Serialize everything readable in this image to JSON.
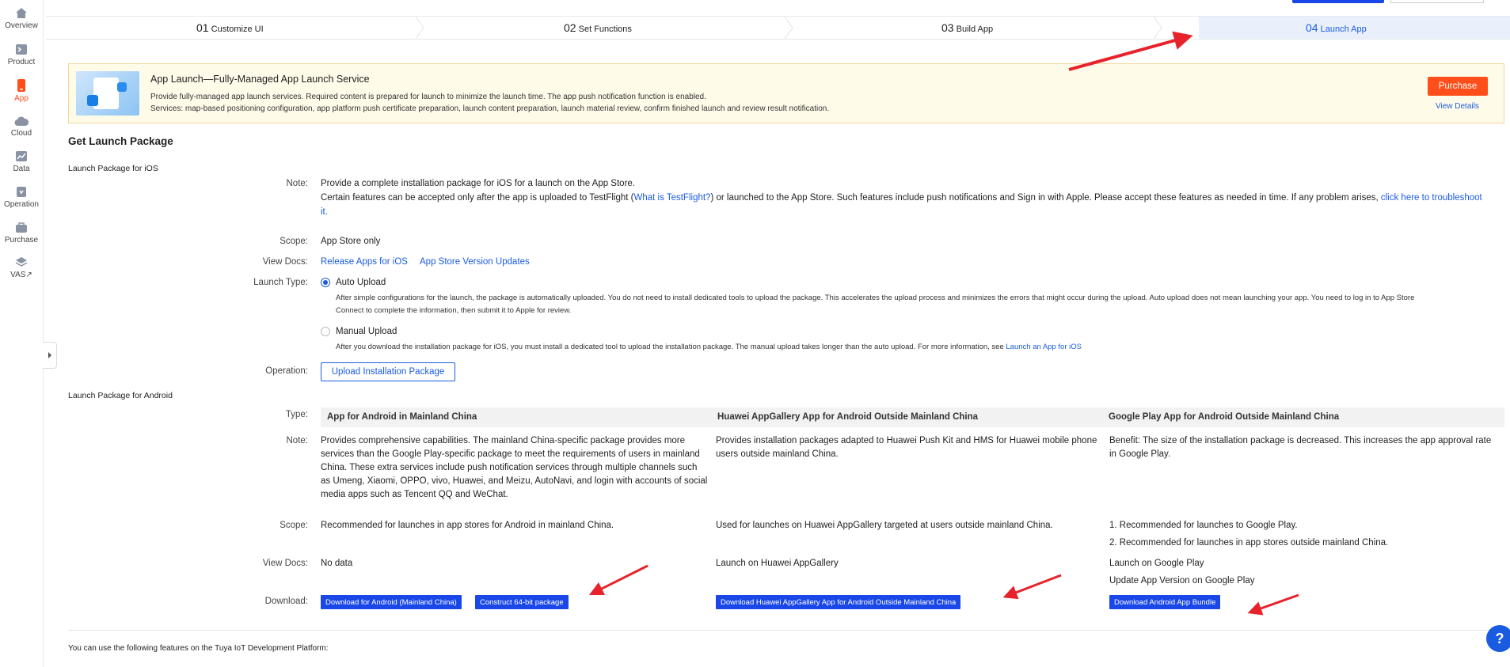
{
  "sidebar": {
    "items": [
      {
        "label": "Overview",
        "icon": "home-icon"
      },
      {
        "label": "Product",
        "icon": "product-icon"
      },
      {
        "label": "App",
        "icon": "app-icon"
      },
      {
        "label": "Cloud",
        "icon": "cloud-icon"
      },
      {
        "label": "Data",
        "icon": "chart-icon"
      },
      {
        "label": "Operation",
        "icon": "operation-icon"
      },
      {
        "label": "Purchase",
        "icon": "purchase-icon"
      },
      {
        "label": "VAS",
        "icon": "vas-icon"
      }
    ],
    "active_color": "#ff4d1a"
  },
  "steps": [
    {
      "num": "01",
      "label": "Customize UI"
    },
    {
      "num": "02",
      "label": "Set Functions"
    },
    {
      "num": "03",
      "label": "Build App"
    },
    {
      "num": "04",
      "label": "Launch App"
    }
  ],
  "banner": {
    "title": "App Launch—Fully-Managed App Launch Service",
    "line1": "Provide fully-managed app launch services. Required content is prepared for launch to minimize the launch time. The app push notification function is enabled.",
    "line2": "Services: map-based positioning configuration, app platform push certificate preparation, launch content preparation, launch material review, confirm finished launch and review result notification.",
    "purchase_label": "Purchase",
    "view_details": "View Details"
  },
  "main": {
    "title": "Get Launch Package",
    "ios": {
      "heading": "Launch Package for iOS",
      "note_label": "Note:",
      "note1": "Provide a complete installation package for iOS for a launch on the App Store.",
      "note2a": "Certain features can be accepted only after the app is uploaded to TestFlight (",
      "note2_link": "What is TestFlight?",
      "note2b": ") or launched to the App Store. Such features include push notifications and Sign in with Apple. Please accept these features as needed in time. If any problem arises,",
      "note2_link2": "click here to troubleshoot",
      "note2_link3": "it.",
      "scope_label": "Scope:",
      "scope": "App Store only",
      "docs_label": "View Docs:",
      "doc1": "Release Apps for iOS",
      "doc2": "App Store Version Updates",
      "launch_type_label": "Launch Type:",
      "auto_label": "Auto Upload",
      "auto_desc1": "After simple configurations for the launch, the package is automatically uploaded. You do not need to install dedicated tools to upload the package. This accelerates the upload process and minimizes the errors that might occur during the upload. Auto upload does not mean launching your app. You need to log in to App Store",
      "auto_desc2": "Connect to complete the information, then submit it to Apple for review.",
      "manual_label": "Manual Upload",
      "manual_desc": "After you download the installation package for iOS, you must install a dedicated tool to upload the installation package. The manual upload takes longer than the auto upload. For more information, see",
      "manual_link": "Launch an App for iOS",
      "operation_label": "Operation:",
      "upload_button": "Upload Installation Package"
    },
    "android": {
      "heading": "Launch Package for Android",
      "type_label": "Type:",
      "note_label": "Note:",
      "scope_label": "Scope:",
      "docs_label": "View Docs:",
      "download_label": "Download:",
      "columns": [
        {
          "header": "App for Android in Mainland China",
          "note_lines": [
            "Provides comprehensive capabilities. The mainland China-specific package provides more",
            "services than the Google Play-specific package to meet the requirements of users in mainland",
            "China. These extra services include push notification services through multiple channels such",
            "as Umeng, Xiaomi, OPPO, vivo, Huawei, and Meizu, AutoNavi, and login with accounts of social",
            "media apps such as Tencent QQ and WeChat."
          ],
          "scope": "Recommended for launches in app stores for Android in mainland China.",
          "docs": "No data",
          "buttons": [
            "Download for Android (Mainland China)",
            "Construct 64-bit package"
          ]
        },
        {
          "header": "Huawei AppGallery App for Android Outside Mainland China",
          "note_lines": [
            "Provides installation packages adapted to Huawei Push Kit and HMS for Huawei mobile phone",
            "users outside mainland China."
          ],
          "scope": "Used for launches on Huawei AppGallery targeted at users outside mainland China.",
          "docs": "Launch on Huawei AppGallery",
          "buttons": [
            "Download Huawei AppGallery App for Android Outside Mainland China"
          ]
        },
        {
          "header": "Google Play App for Android Outside Mainland China",
          "note_lines": [
            "Benefit: The size of the installation package is decreased. This increases the app approval rate",
            "in Google Play."
          ],
          "scope1": "1. Recommended for launches to Google Play.",
          "scope2": "2. Recommended for launches in app stores outside mainland China.",
          "docs1": "Launch on Google Play",
          "docs2": "Update App Version on Google Play",
          "buttons": [
            "Download Android App Bundle"
          ]
        }
      ]
    },
    "footer": "You can use the following features on the Tuya IoT Development Platform:"
  },
  "colors": {
    "primary": "#1a5ce0",
    "button_blue": "#1a47e8",
    "orange": "#ff4e1a",
    "arrow": "#e8222a"
  }
}
